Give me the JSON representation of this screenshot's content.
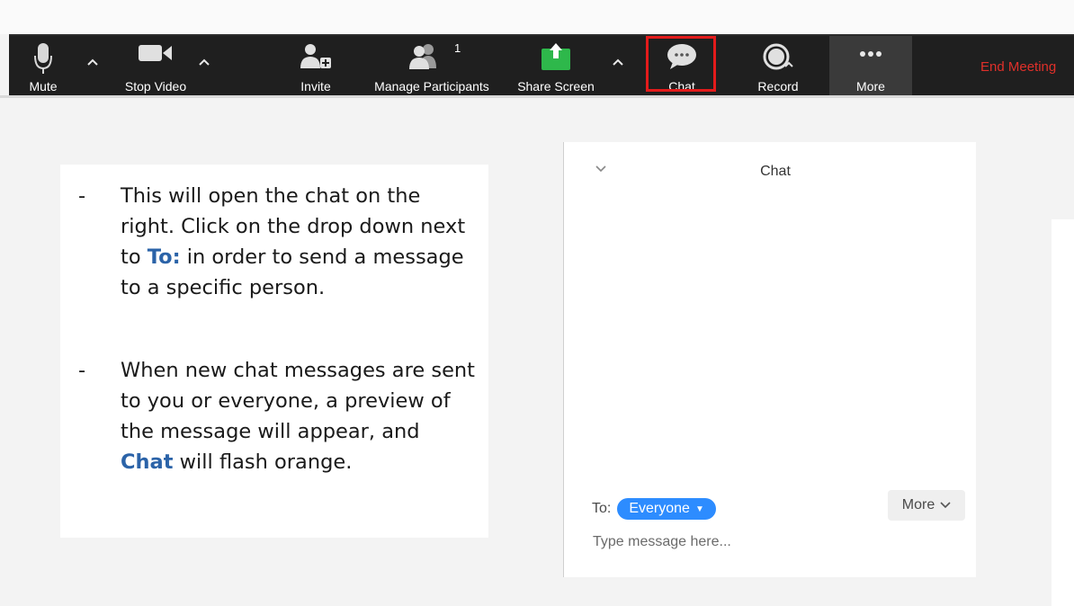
{
  "toolbar": {
    "mute_label": "Mute",
    "stop_video_label": "Stop Video",
    "invite_label": "Invite",
    "manage_participants_label": "Manage Participants",
    "participant_count": "1",
    "share_screen_label": "Share Screen",
    "chat_label": "Chat",
    "record_label": "Record",
    "more_label": "More",
    "end_meeting_label": "End Meeting",
    "icons": {
      "mute": "microphone-icon",
      "stop_video": "video-camera-icon",
      "invite": "add-person-icon",
      "participants": "people-icon",
      "share": "share-screen-icon",
      "chat": "chat-bubble-icon",
      "record": "record-icon",
      "more": "ellipsis-icon"
    },
    "colors": {
      "share_green": "#2eb84b",
      "end_meeting": "#e0302a",
      "highlight": "#e31b1b"
    }
  },
  "instructions": {
    "bullet1": {
      "dash": "-",
      "part1": "This will open the chat on the right. Click on the drop down next to ",
      "highlight": "To:",
      "part2": " in order to send a message to a specific person."
    },
    "bullet2": {
      "dash": "-",
      "part1": "When new chat messages are sent to you or everyone, a preview of the message will appear, and ",
      "highlight": "Chat",
      "part2": " will flash orange."
    }
  },
  "chat_panel": {
    "title": "Chat",
    "to_label": "To:",
    "recipient": "Everyone",
    "more_label": "More",
    "input_placeholder": "Type message here...",
    "colors": {
      "pill": "#2d8cff"
    }
  }
}
